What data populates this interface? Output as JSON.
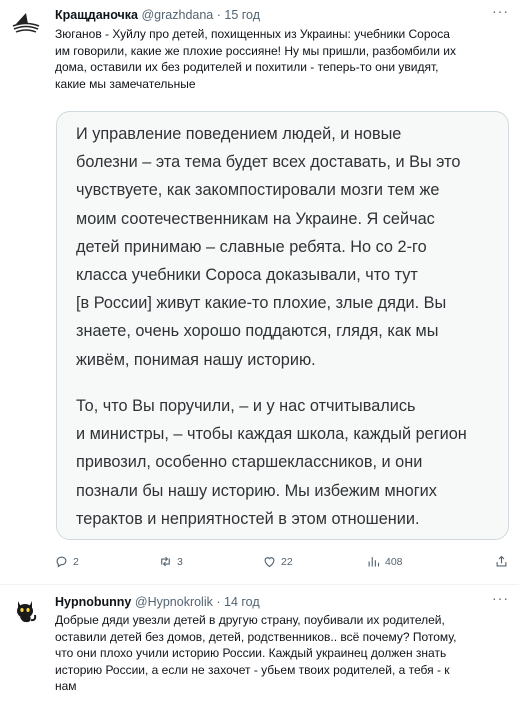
{
  "tweet1": {
    "author_name": "Кращданочка",
    "handle": "@grazhdana",
    "separator": "·",
    "time": "15 год",
    "more": "···",
    "text_lines": [
      "Зюганов - Хуйлу про детей, похищенных из Украины: учебники Сороса",
      "им говорили, какие же плохие россияне! Ну мы пришли, разбомбили их",
      "дома, оставили их без родителей и похитили - теперь-то они увидят,",
      "какие мы замечательные"
    ],
    "quote_paragraph1": [
      "И управление поведением людей, и новые",
      "болезни – эта тема будет всех доставать, и Вы это",
      "чувствуете, как закомпостировали мозги тем же",
      "моим соотечественникам на Украине. Я сейчас",
      "детей принимаю – славные ребята. Но со 2-го",
      "класса учебники Сороса доказывали, что тут",
      "[в России] живут какие-то плохие, злые дяди. Вы",
      "знаете, очень хорошо поддаются, глядя, как мы",
      "живём, понимая нашу историю."
    ],
    "quote_paragraph2": [
      "То, что Вы поручили, – и у нас отчитывались",
      "и министры, – чтобы каждая школа, каждый регион",
      "привозил, особенно старшеклассников, и они",
      "познали бы нашу историю. Мы избежим многих",
      "терактов и неприятностей в этом отношении."
    ],
    "actions": {
      "replies": "2",
      "retweets": "3",
      "likes": "22",
      "views": "408"
    }
  },
  "tweet2": {
    "author_name": "Hypnobunny",
    "handle": "@Hypnokrolik",
    "separator": "·",
    "time": "14 год",
    "more": "···",
    "text_lines": [
      "Добрые дяди увезли детей  в другую страну, поубивали их родителей,",
      "оставили детей без домов, детей, родственников.. всё почему? Потому,",
      "что они плохо учили историю России. Каждый украинец должен знать",
      "историю России, а если не захочет - убьем твоих родителей, а тебя - к",
      "нам"
    ]
  },
  "colors": {
    "text": "#0f1419",
    "muted": "#536471",
    "border": "#cfd9de",
    "card_bg": "#f7f9f9"
  },
  "icons": [
    "shark-avatar-icon",
    "cat-avatar-icon",
    "reply-icon",
    "retweet-icon",
    "like-icon",
    "views-icon",
    "share-icon",
    "more-icon"
  ]
}
